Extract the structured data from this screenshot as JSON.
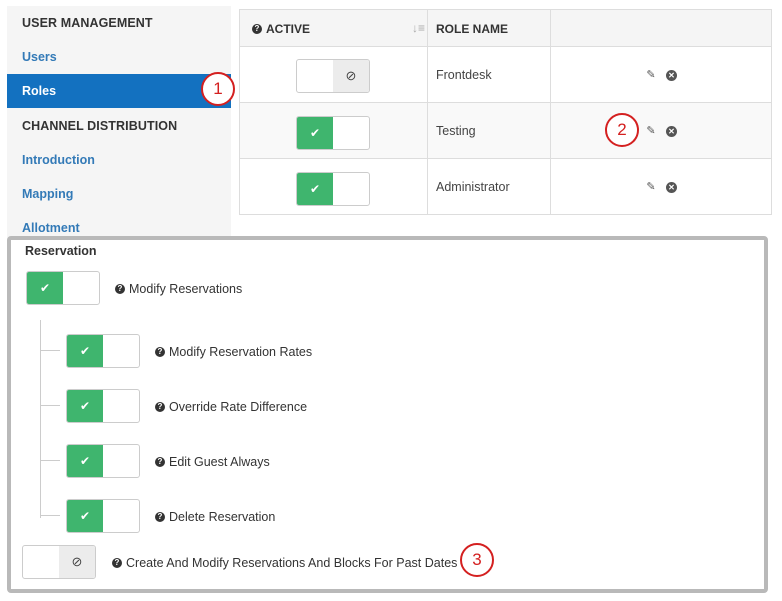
{
  "sidebar": {
    "section1_title": "USER MANAGEMENT",
    "items": [
      {
        "label": "Users"
      },
      {
        "label": "Roles",
        "active": true
      },
      {
        "label": "Introduction"
      },
      {
        "label": "Mapping"
      },
      {
        "label": "Allotment"
      }
    ],
    "section2_title": "CHANNEL DISTRIBUTION"
  },
  "roles_table": {
    "columns": {
      "active": "ACTIVE",
      "role_name": "ROLE NAME",
      "actions": ""
    },
    "sort_icon": "sort-amount-desc-icon",
    "rows": [
      {
        "active": false,
        "role_name": "Frontdesk"
      },
      {
        "active": true,
        "role_name": "Testing"
      },
      {
        "active": true,
        "role_name": "Administrator"
      }
    ],
    "row_actions": [
      "edit-icon",
      "remove-icon"
    ]
  },
  "reservation_panel": {
    "title": "Reservation",
    "parent_permission": {
      "label": "Modify Reservations",
      "enabled": true
    },
    "child_permissions": [
      {
        "label": "Modify Reservation Rates",
        "enabled": true
      },
      {
        "label": "Override Rate Difference",
        "enabled": true
      },
      {
        "label": "Edit Guest Always",
        "enabled": true
      },
      {
        "label": "Delete Reservation",
        "enabled": true
      }
    ],
    "past_dates_permission": {
      "label": "Create And Modify Reservations And Blocks For Past Dates",
      "enabled": false
    }
  },
  "callouts": [
    "1",
    "2",
    "3"
  ],
  "colors": {
    "sidebar_active": "#1371c0",
    "link": "#337ab7",
    "switch_on": "#3fb56e",
    "callout": "#d42020"
  }
}
